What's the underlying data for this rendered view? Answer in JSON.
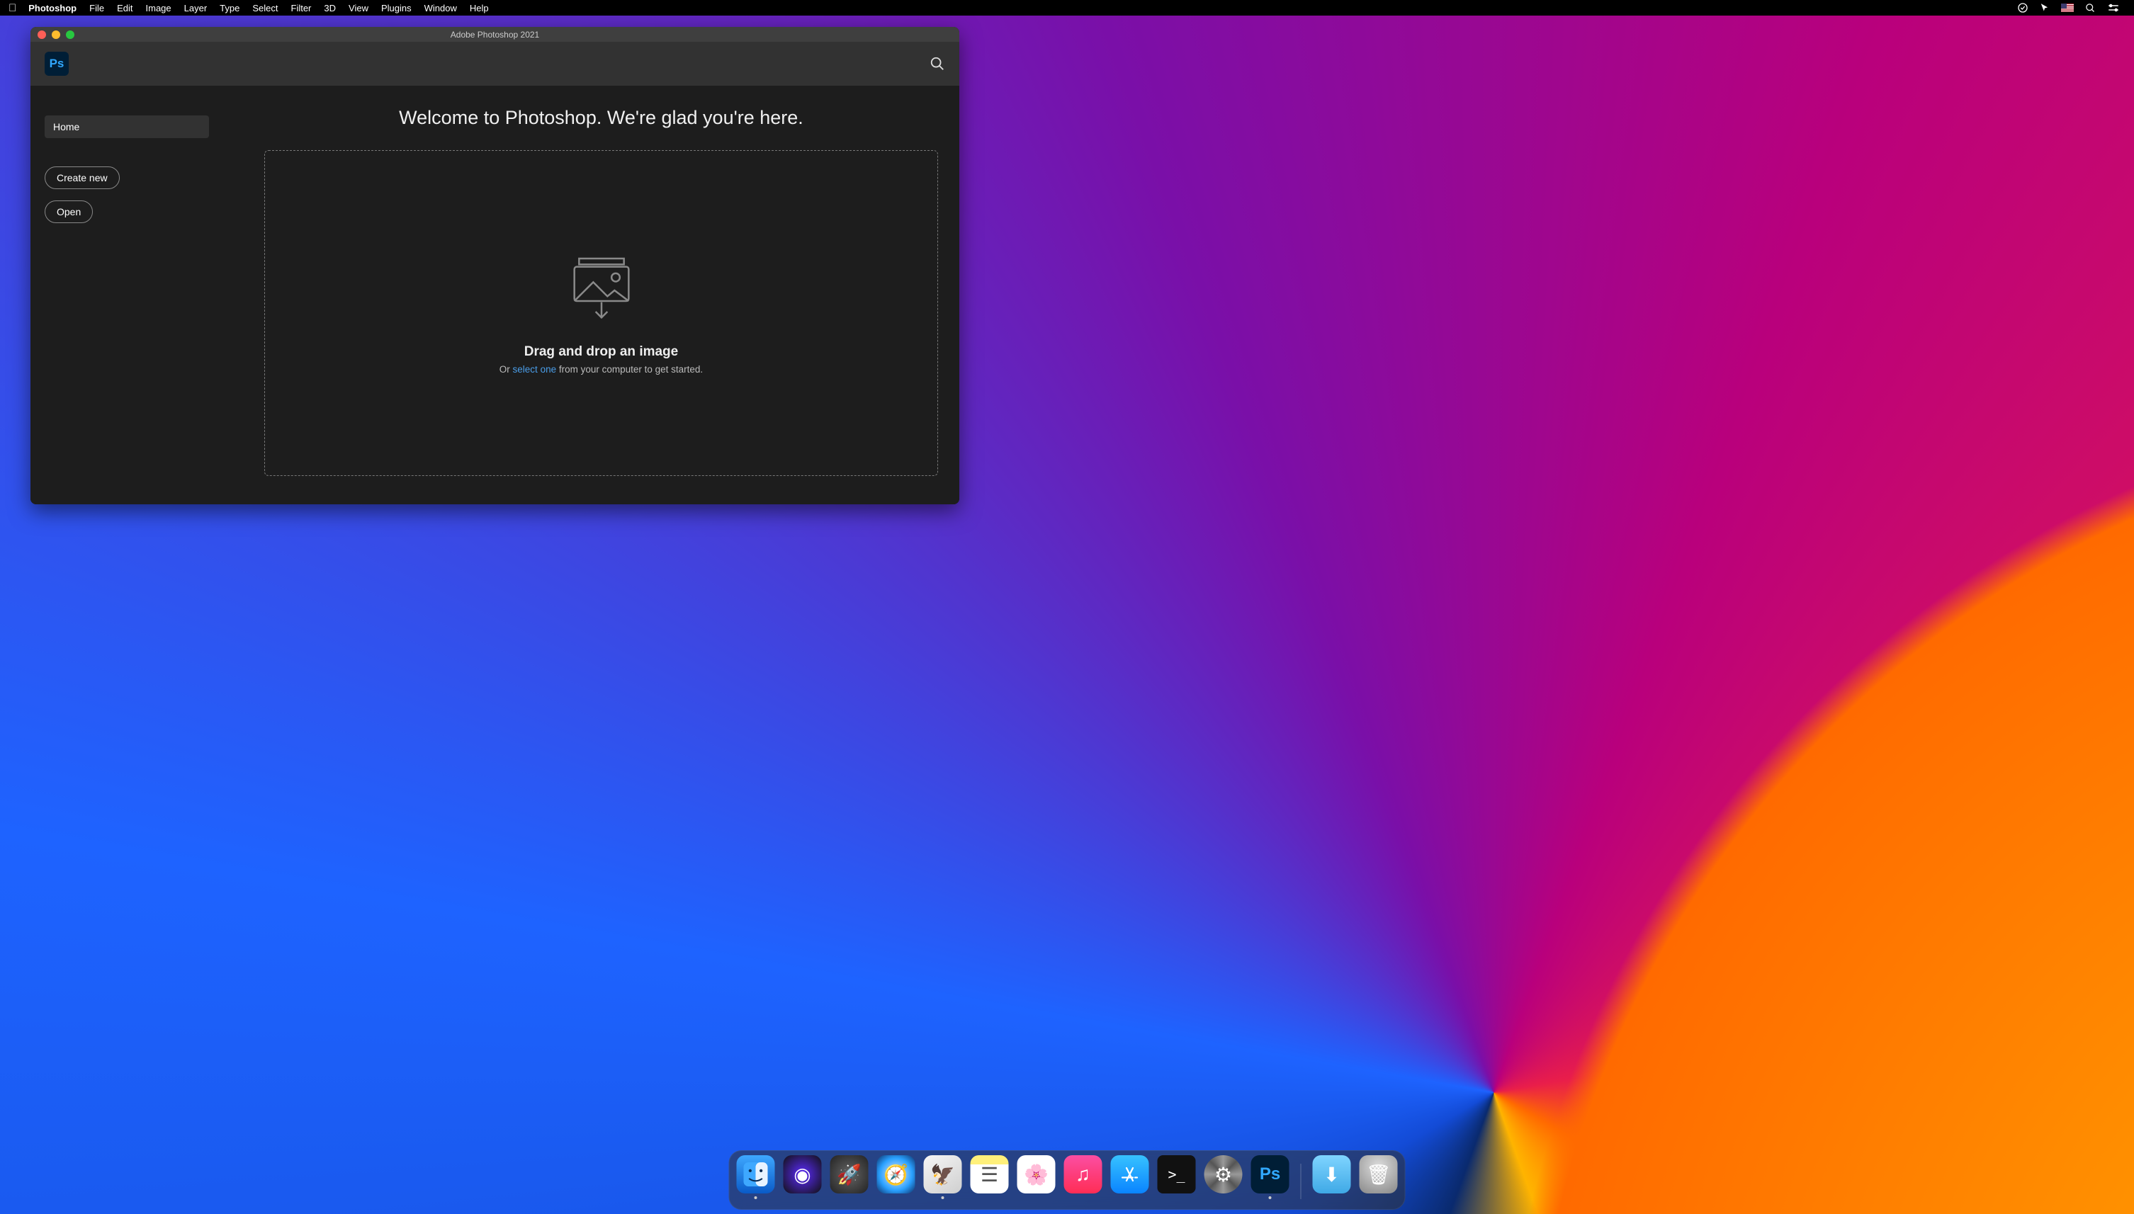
{
  "menubar": {
    "app": "Photoshop",
    "items": [
      "File",
      "Edit",
      "Image",
      "Layer",
      "Type",
      "Select",
      "Filter",
      "3D",
      "View",
      "Plugins",
      "Window",
      "Help"
    ],
    "right_icons": [
      "cc-icon",
      "cursor-icon",
      "keyboard-flag-us",
      "spotlight-icon",
      "control-center-icon"
    ]
  },
  "window": {
    "title": "Adobe Photoshop 2021",
    "logo_text": "Ps"
  },
  "sidebar": {
    "nav_home": "Home",
    "btn_create": "Create new",
    "btn_open": "Open"
  },
  "main": {
    "welcome": "Welcome to Photoshop. We're glad you're here.",
    "dz_title": "Drag and drop an image",
    "dz_or": "Or ",
    "dz_link": "select one",
    "dz_rest": " from your computer to get started."
  },
  "dock": {
    "items": [
      {
        "name": "finder",
        "running": true
      },
      {
        "name": "siri",
        "running": false
      },
      {
        "name": "launchpad",
        "running": false
      },
      {
        "name": "safari",
        "running": false
      },
      {
        "name": "mail",
        "running": true
      },
      {
        "name": "notes",
        "running": false
      },
      {
        "name": "photos",
        "running": false
      },
      {
        "name": "music",
        "running": false
      },
      {
        "name": "appstore",
        "running": false
      },
      {
        "name": "terminal",
        "running": false
      },
      {
        "name": "system-preferences",
        "running": false
      },
      {
        "name": "photoshop",
        "running": true
      }
    ],
    "after_sep": [
      {
        "name": "downloads-folder"
      },
      {
        "name": "trash"
      }
    ]
  }
}
